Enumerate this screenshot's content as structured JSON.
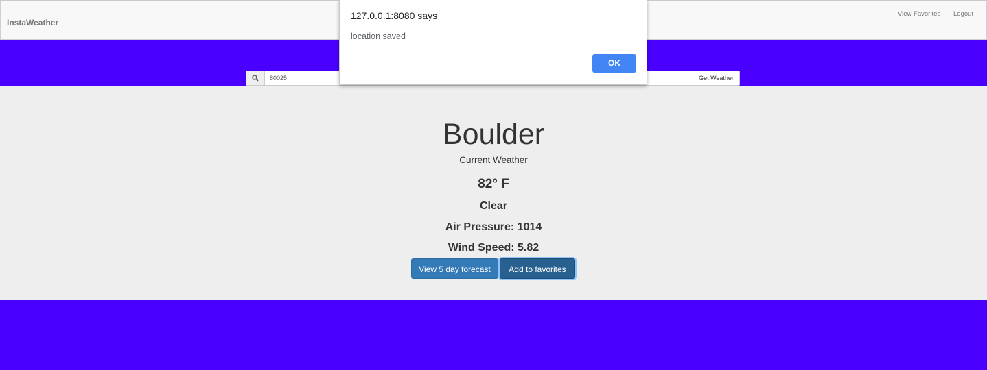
{
  "navbar": {
    "brand": "InstaWeather",
    "links": [
      "View Favorites",
      "Logout"
    ]
  },
  "search": {
    "value": "80025",
    "button_label": "Get Weather"
  },
  "weather": {
    "city": "Boulder",
    "subtitle": "Current Weather",
    "temperature": "82° F",
    "condition": "Clear",
    "pressure": "Air Pressure: 1014",
    "wind": "Wind Speed: 5.82"
  },
  "actions": {
    "forecast_label": "View 5 day forecast",
    "favorites_label": "Add to favorites"
  },
  "dialog": {
    "title": "127.0.0.1:8080 says",
    "message": "location saved",
    "ok_label": "OK"
  },
  "colors": {
    "background": "#4a00ff",
    "panel": "#eeeeee",
    "primary_button": "#337ab7",
    "dialog_ok": "#4285f4"
  }
}
